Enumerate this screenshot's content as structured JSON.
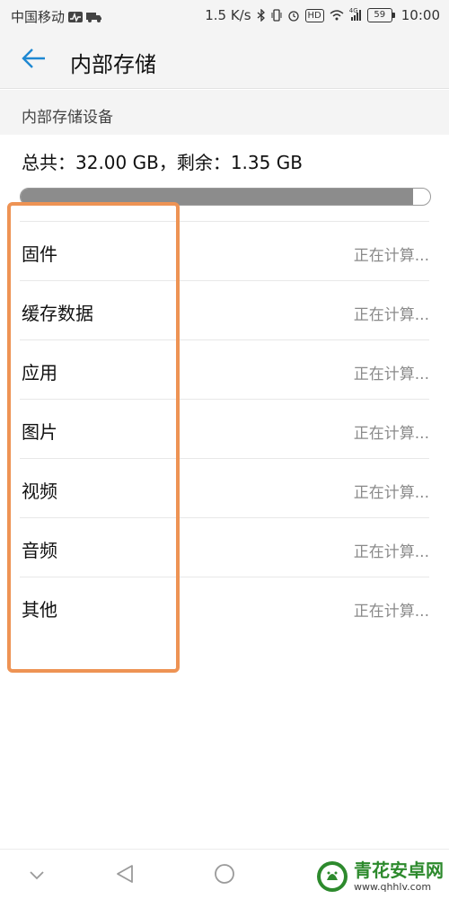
{
  "status_bar": {
    "carrier": "中国移动",
    "speed": "1.5 K/s",
    "hd_badge": "HD",
    "network_badge": "4G",
    "battery": "59",
    "time": "10:00",
    "icons": [
      "activity-icon",
      "truck-icon",
      "bluetooth-icon",
      "vibrate-icon",
      "alarm-icon",
      "wifi-icon",
      "signal-icon"
    ]
  },
  "header": {
    "back_icon": "arrow-left-icon",
    "title": "内部存储"
  },
  "section": {
    "title": "内部存储设备"
  },
  "summary": {
    "text": "总共：32.00 GB，剩余：1.35 GB",
    "used_fraction": 0.958
  },
  "storage_items": [
    {
      "label": "固件",
      "value": "正在计算..."
    },
    {
      "label": "缓存数据",
      "value": "正在计算..."
    },
    {
      "label": "应用",
      "value": "正在计算..."
    },
    {
      "label": "图片",
      "value": "正在计算..."
    },
    {
      "label": "视频",
      "value": "正在计算..."
    },
    {
      "label": "音频",
      "value": "正在计算..."
    },
    {
      "label": "其他",
      "value": "正在计算..."
    }
  ],
  "navbar": {
    "icons": [
      "chevron-down-icon",
      "back-triangle-icon",
      "home-circle-icon"
    ]
  },
  "watermark": {
    "name": "青花安卓网",
    "url": "www.qhhlv.com"
  },
  "colors": {
    "accent_blue": "#1e88d2",
    "highlight_orange": "#ee9354",
    "progress_fill": "#8c8c8c",
    "watermark_green": "#2d8a2d"
  }
}
